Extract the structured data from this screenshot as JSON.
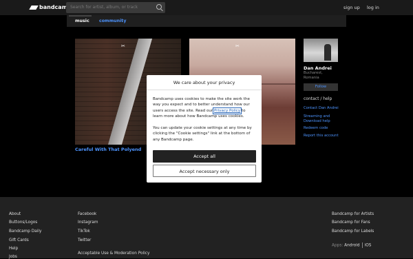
{
  "header": {
    "logo_text": "bandcamp",
    "search_placeholder": "Search for artist, album, or track",
    "signup_label": "sign up",
    "login_label": "log in"
  },
  "subnav": {
    "tabs": [
      {
        "label": "music"
      },
      {
        "label": "community"
      }
    ]
  },
  "albums": [
    {
      "title": "Careful With That Polyend",
      "mark": "✂"
    },
    {
      "title": "",
      "mark": "✂"
    }
  ],
  "artist": {
    "name": "Dan Andrei",
    "location_line1": "Bucharest,",
    "location_line2": "Romania",
    "follow_label": "Follow",
    "contact_heading": "contact / help",
    "links": [
      "Contact Dan Andrei",
      "Streaming and",
      "Download help",
      "Redeem code",
      "Report this account"
    ]
  },
  "cookie_modal": {
    "title": "We care about your privacy",
    "para1_before": "Bandcamp uses cookies to make the site work the way you expect and to better understand how our users access the site. Read our ",
    "policy_link": "Privacy Policy",
    "para1_after": " to learn more about how Bandcamp uses cookies.",
    "para2": "You can update your cookie settings at any time by clicking the \"Cookie settings\" link at the bottom of any Bandcamp page.",
    "accept_all": "Accept all",
    "accept_necessary": "Accept necessary only"
  },
  "footer": {
    "col1": [
      "About",
      "Buttons/Logos",
      "Bandcamp Daily",
      "Gift Cards",
      "Help",
      "Jobs"
    ],
    "col2": [
      "Facebook",
      "Instagram",
      "TikTok",
      "Twitter",
      "Acceptable Use & Moderation Policy"
    ],
    "col3": [
      "Bandcamp for Artists",
      "Bandcamp for Fans",
      "Bandcamp for Labels"
    ],
    "apps_label": "Apps:",
    "apps": [
      "Android",
      "iOS"
    ]
  },
  "colors": {
    "accent": "#4d94ff",
    "background": "#000000",
    "footer": "#222222"
  }
}
